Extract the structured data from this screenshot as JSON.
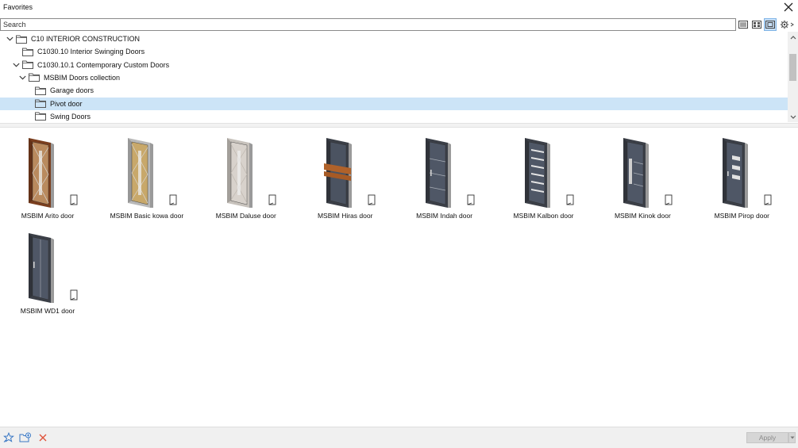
{
  "window": {
    "title": "Favorites"
  },
  "search": {
    "placeholder": "Search",
    "value": ""
  },
  "view_buttons": [
    {
      "name": "list-view-icon",
      "active": false
    },
    {
      "name": "grid-view-icon",
      "active": false
    },
    {
      "name": "preview-view-icon",
      "active": true
    },
    {
      "name": "settings-gear-icon",
      "active": false
    }
  ],
  "tree": [
    {
      "label": "C10 INTERIOR CONSTRUCTION",
      "indent": 0,
      "expanded": true,
      "has_children": true,
      "selected": false
    },
    {
      "label": "C1030.10 Interior Swinging Doors",
      "indent": 1,
      "expanded": false,
      "has_children": false,
      "selected": false
    },
    {
      "label": "C1030.10.1 Contemporary Custom Doors",
      "indent": 1,
      "expanded": true,
      "has_children": true,
      "selected": false
    },
    {
      "label": "MSBIM Doors collection",
      "indent": 2,
      "expanded": true,
      "has_children": true,
      "selected": false
    },
    {
      "label": "Garage doors",
      "indent": 3,
      "expanded": false,
      "has_children": false,
      "selected": false
    },
    {
      "label": "Pivot door",
      "indent": 3,
      "expanded": false,
      "has_children": false,
      "selected": true
    },
    {
      "label": "Swing Doors",
      "indent": 3,
      "expanded": false,
      "has_children": false,
      "selected": false
    }
  ],
  "items": [
    {
      "name": "MSBIM Arito door",
      "frame": "#7a3e1e",
      "panel": "#b98a5e",
      "style": "cross"
    },
    {
      "name": "MSBIM Basic kowa door",
      "frame": "#b9b9b9",
      "panel": "#c8a86a",
      "style": "cross"
    },
    {
      "name": "MSBIM Daluse door",
      "frame": "#c7c2bc",
      "panel": "#d8d2cc",
      "style": "cross-light"
    },
    {
      "name": "MSBIM Hiras door",
      "frame": "#3b3f47",
      "panel": "#4b5361",
      "style": "wood-band"
    },
    {
      "name": "MSBIM Indah door",
      "frame": "#3b3f47",
      "panel": "#4f5766",
      "style": "lines"
    },
    {
      "name": "MSBIM Kalbon door",
      "frame": "#3b3f47",
      "panel": "#4f5766",
      "style": "slats"
    },
    {
      "name": "MSBIM Kinok door",
      "frame": "#3b3f47",
      "panel": "#4f5766",
      "style": "handle-lines"
    },
    {
      "name": "MSBIM Pirop door",
      "frame": "#3b3f47",
      "panel": "#4f5766",
      "style": "windows"
    },
    {
      "name": "MSBIM WD1 door",
      "frame": "#3b3f47",
      "panel": "#4f5766",
      "style": "plain"
    }
  ],
  "footer": {
    "icons": [
      "add-favorite-star-icon",
      "new-folder-icon",
      "delete-x-icon"
    ],
    "apply_label": "Apply"
  },
  "colors": {
    "selection": "#cce4f7",
    "delete": "#e0533b",
    "accent": "#3a78c4"
  }
}
